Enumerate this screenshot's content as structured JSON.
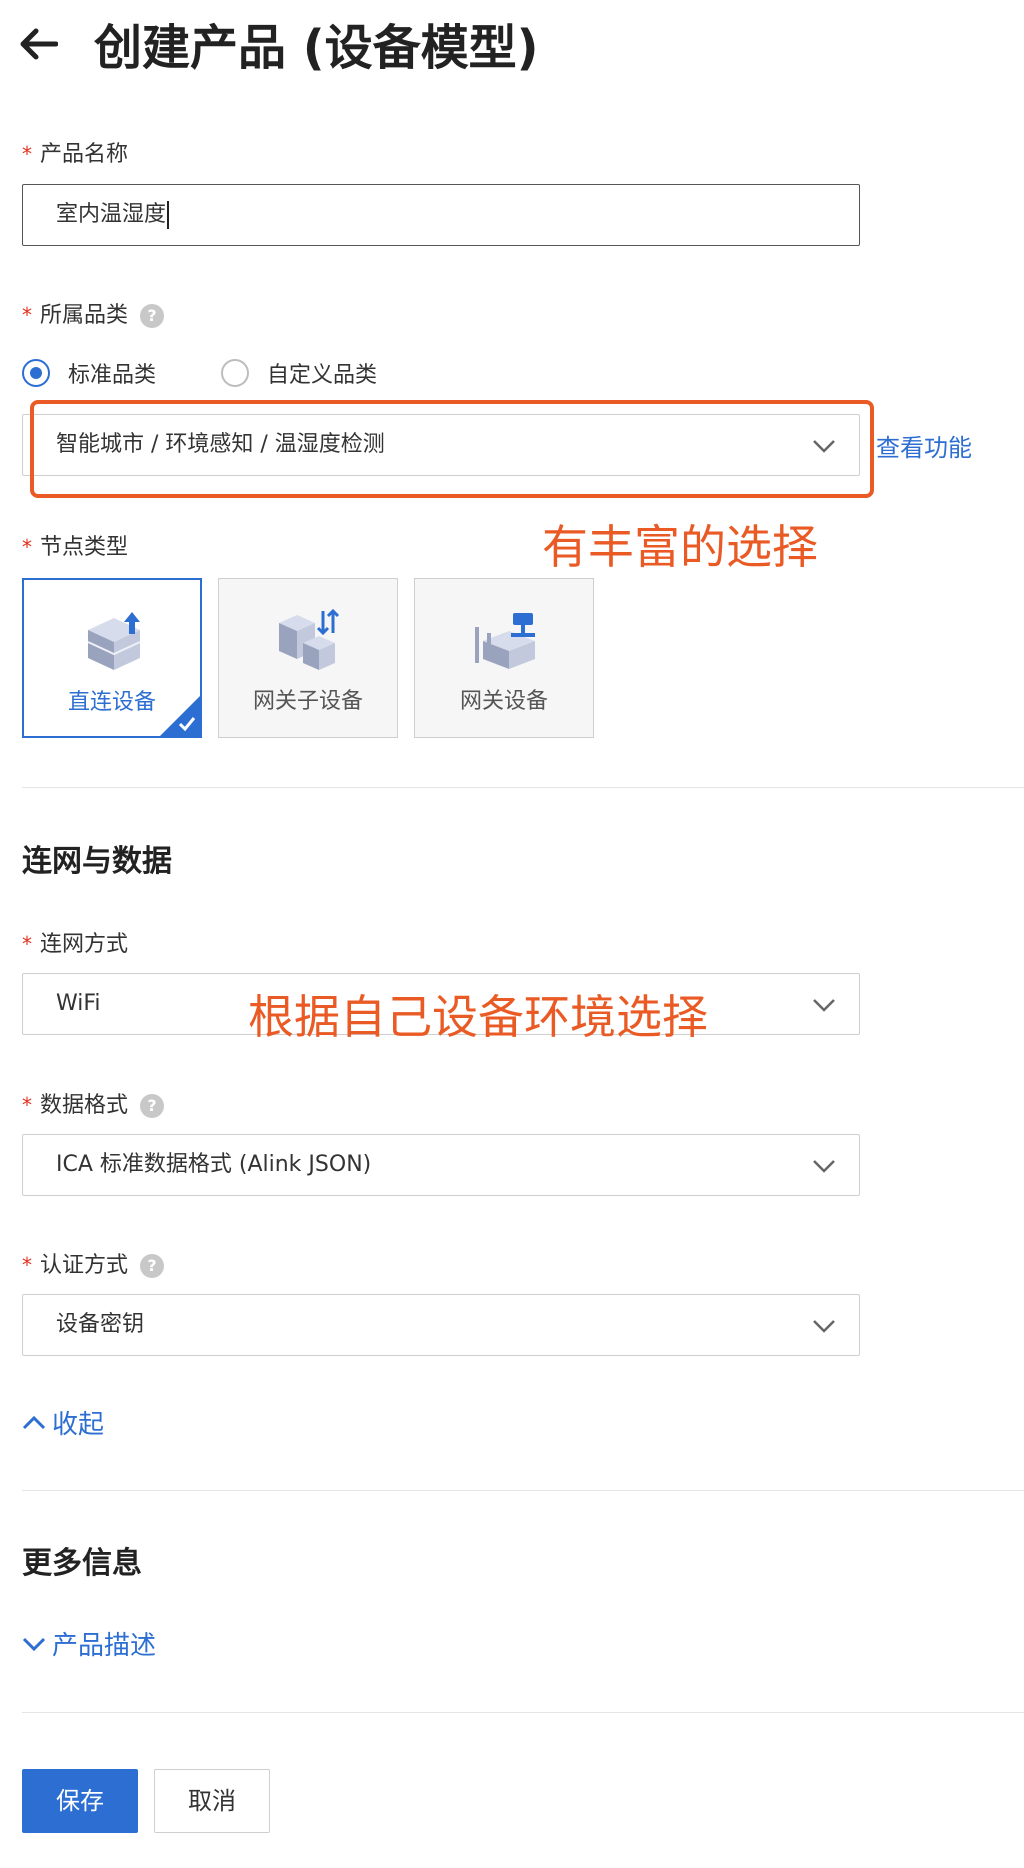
{
  "header": {
    "title": "创建产品 (设备模型)"
  },
  "product_name": {
    "label": "产品名称",
    "value": "室内温湿度"
  },
  "category": {
    "label": "所属品类",
    "options": [
      "标准品类",
      "自定义品类"
    ],
    "selected_option": "标准品类",
    "value": "智能城市 / 环境感知 / 温湿度检测",
    "view_features": "查看功能"
  },
  "annotations": {
    "category_note": "有丰富的选择",
    "network_note": "根据自己设备环境选择"
  },
  "node_type": {
    "label": "节点类型",
    "cards": [
      {
        "label": "直连设备",
        "selected": true
      },
      {
        "label": "网关子设备",
        "selected": false
      },
      {
        "label": "网关设备",
        "selected": false
      }
    ]
  },
  "network_section": {
    "title": "连网与数据",
    "connection": {
      "label": "连网方式",
      "value": "WiFi"
    },
    "data_format": {
      "label": "数据格式",
      "value": "ICA 标准数据格式 (Alink JSON)"
    },
    "auth": {
      "label": "认证方式",
      "value": "设备密钥"
    },
    "collapse_link": "收起"
  },
  "more_section": {
    "title": "更多信息",
    "description_link": "产品描述"
  },
  "actions": {
    "save": "保存",
    "cancel": "取消"
  },
  "colors": {
    "primary": "#2d6ed2",
    "required": "#e0301e",
    "annotation": "#ea5a24"
  },
  "icons": {
    "help": "?"
  }
}
